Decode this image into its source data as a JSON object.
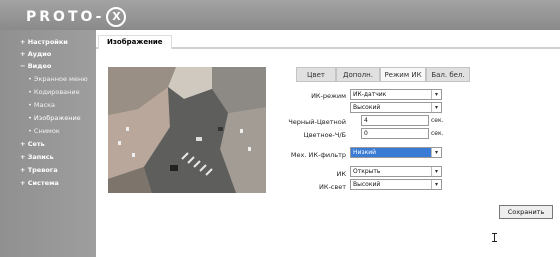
{
  "brand": {
    "logo_text": "PROTO-",
    "logo_mark": "X"
  },
  "sidebar": {
    "items": [
      {
        "label": "Настройки",
        "bullet": "+"
      },
      {
        "label": "Аудио",
        "bullet": "+"
      },
      {
        "label": "Видео",
        "bullet": "−"
      },
      {
        "label": "Экранное меню",
        "bullet": "•"
      },
      {
        "label": "Кодирование",
        "bullet": "•"
      },
      {
        "label": "Маска",
        "bullet": "•"
      },
      {
        "label": "Изображение",
        "bullet": "•"
      },
      {
        "label": "Снимок",
        "bullet": "•"
      },
      {
        "label": "Сеть",
        "bullet": "+"
      },
      {
        "label": "Запись",
        "bullet": "+"
      },
      {
        "label": "Тревога",
        "bullet": "+"
      },
      {
        "label": "Система",
        "bullet": "+"
      }
    ]
  },
  "page": {
    "tab_title": "Изображение"
  },
  "tabs": [
    "Цвет",
    "Дополн.",
    "Режим ИК",
    "Бал. бел."
  ],
  "active_tab_index": 2,
  "form": {
    "ir_mode_label": "ИК-режим",
    "ir_mode_value": "ИК-датчик",
    "level_value": "Высокий",
    "bw_color_label": "Черный-Цветной",
    "bw_color_value": "4",
    "bw_color_unit": "сек.",
    "color_bw_label": "Цветное-Ч/Б",
    "color_bw_value": "0",
    "color_bw_unit": "сек.",
    "mech_filter_label": "Мех. ИК-фильтр",
    "mech_filter_value": "Низкий",
    "ir_label": "ИК",
    "ir_value": "Открыть",
    "ir_light_label": "ИК-свет",
    "ir_light_value": "Высокий"
  },
  "save_label": "Сохранить",
  "arrow_glyph": "▾",
  "colors": {
    "header": "#8a8a8a",
    "sidebar": "#999999",
    "active_select": "#3a7bd5"
  }
}
